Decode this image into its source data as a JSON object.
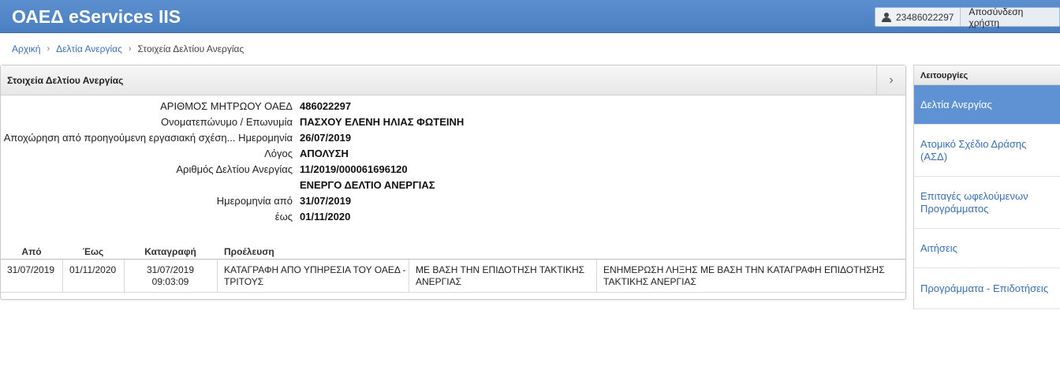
{
  "header": {
    "title": "ΟΑΕΔ eServices IIS",
    "user_id": "23486022297",
    "logout_label": "Αποσύνδεση χρήστη"
  },
  "breadcrumb": {
    "home": "Αρχική",
    "section": "Δελτία Ανεργίας",
    "current": "Στοιχεία Δελτίου Ανεργίας"
  },
  "panel": {
    "title": "Στοιχεία Δελτίου Ανεργίας",
    "toggle_glyph": "›",
    "fields": [
      {
        "label": "ΑΡΙΘΜΟΣ ΜΗΤΡΩΟΥ ΟΑΕΔ",
        "value": "486022297"
      },
      {
        "label": "Ονοματεπώνυμο / Επωνυμία",
        "value": "ΠΑΣΧΟΥ ΕΛΕΝΗ ΗΛΙΑΣ ΦΩΤΕΙΝΗ"
      },
      {
        "label": "Αποχώρηση από προηγούμενη εργασιακή σχέση... Ημερομηνία",
        "value": "26/07/2019"
      },
      {
        "label": "Λόγος",
        "value": "ΑΠΟΛΥΣΗ"
      },
      {
        "label": "Αριθμός Δελτίου Ανεργίας",
        "value": "11/2019/000061696120"
      },
      {
        "label": "",
        "value": "ΕΝΕΡΓΟ ΔΕΛΤΙΟ ΑΝΕΡΓΙΑΣ"
      },
      {
        "label": "Ημερομηνία από",
        "value": "31/07/2019"
      },
      {
        "label": "έως",
        "value": "01/11/2020"
      }
    ],
    "table": {
      "headers": [
        "Από",
        "Έως",
        "Καταγραφή",
        "Προέλευση"
      ],
      "rows": [
        {
          "from": "31/07/2019",
          "to": "01/11/2020",
          "recorded_date": "31/07/2019",
          "recorded_time": "09:03:09",
          "origin_1": "ΚΑΤΑΓΡΑΦΗ ΑΠΟ ΥΠΗΡΕΣΙΑ ΤΟΥ ΟΑΕΔ - ΤΡΙΤΟΥΣ",
          "origin_2": "ΜΕ ΒΑΣΗ ΤΗΝ ΕΠΙΔΟΤΗΣΗ ΤΑΚΤΙΚΗΣ ΑΝΕΡΓΙΑΣ",
          "origin_3": "ΕΝΗΜΕΡΩΣΗ ΛΗΞΗΣ ΜΕ ΒΑΣΗ ΤΗΝ ΚΑΤΑΓΡΑΦΗ ΕΠΙΔΟΤΗΣΗΣ ΤΑΚΤΙΚΗΣ ΑΝΕΡΓΙΑΣ"
        }
      ]
    }
  },
  "sidebar": {
    "title": "Λειτουργίες",
    "items": [
      {
        "label": "Δελτία Ανεργίας",
        "active": true
      },
      {
        "label": "Ατομικό Σχέδιο Δράσης (ΑΣΔ)",
        "active": false
      },
      {
        "label": "Επιταγές ωφελούμενων Προγράμματος",
        "active": false
      },
      {
        "label": "Αιτήσεις",
        "active": false
      },
      {
        "label": "Προγράμματα - Επιδοτήσεις",
        "active": false
      }
    ]
  }
}
